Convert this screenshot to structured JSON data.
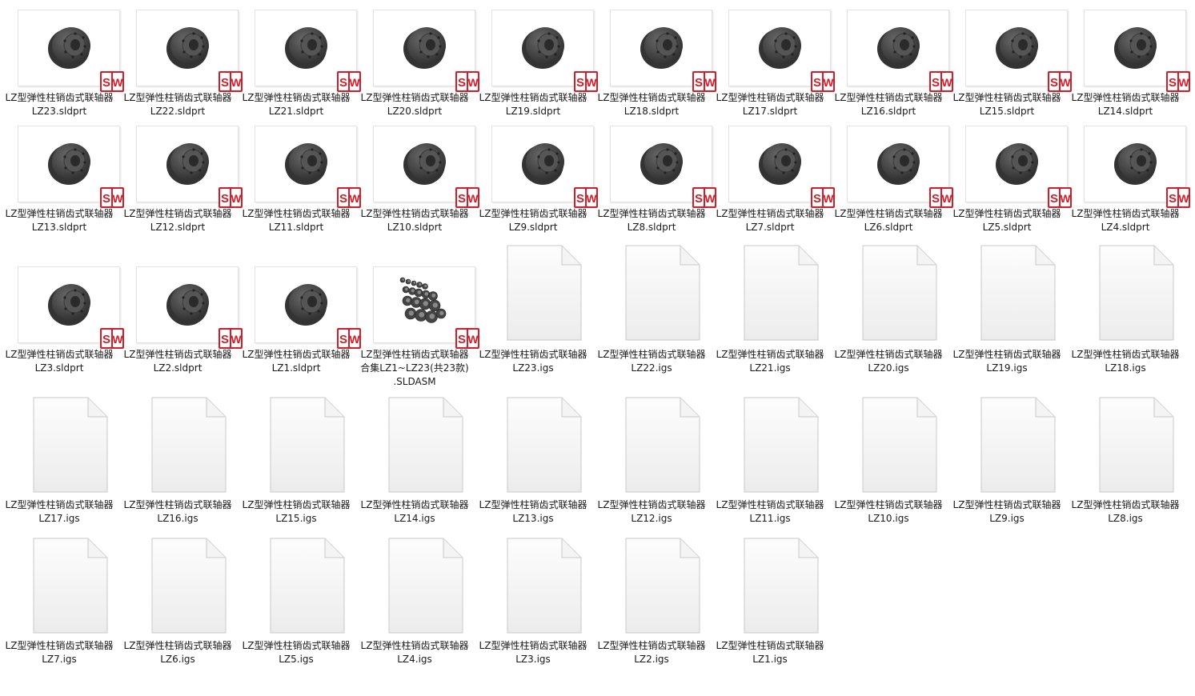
{
  "prefix": "LZ型弹性柱销齿式联轴器",
  "files": [
    {
      "name": "LZ23.sldprt",
      "kind": "sldprt"
    },
    {
      "name": "LZ22.sldprt",
      "kind": "sldprt"
    },
    {
      "name": "LZ21.sldprt",
      "kind": "sldprt"
    },
    {
      "name": "LZ20.sldprt",
      "kind": "sldprt"
    },
    {
      "name": "LZ19.sldprt",
      "kind": "sldprt"
    },
    {
      "name": "LZ18.sldprt",
      "kind": "sldprt"
    },
    {
      "name": "LZ17.sldprt",
      "kind": "sldprt"
    },
    {
      "name": "LZ16.sldprt",
      "kind": "sldprt"
    },
    {
      "name": "LZ15.sldprt",
      "kind": "sldprt"
    },
    {
      "name": "LZ14.sldprt",
      "kind": "sldprt"
    },
    {
      "name": "LZ13.sldprt",
      "kind": "sldprt"
    },
    {
      "name": "LZ12.sldprt",
      "kind": "sldprt"
    },
    {
      "name": "LZ11.sldprt",
      "kind": "sldprt"
    },
    {
      "name": "LZ10.sldprt",
      "kind": "sldprt"
    },
    {
      "name": "LZ9.sldprt",
      "kind": "sldprt"
    },
    {
      "name": "LZ8.sldprt",
      "kind": "sldprt"
    },
    {
      "name": "LZ7.sldprt",
      "kind": "sldprt"
    },
    {
      "name": "LZ6.sldprt",
      "kind": "sldprt"
    },
    {
      "name": "LZ5.sldprt",
      "kind": "sldprt"
    },
    {
      "name": "LZ4.sldprt",
      "kind": "sldprt"
    },
    {
      "name": "LZ3.sldprt",
      "kind": "sldprt"
    },
    {
      "name": "LZ2.sldprt",
      "kind": "sldprt"
    },
    {
      "name": "LZ1.sldprt",
      "kind": "sldprt"
    },
    {
      "name": "合集LZ1~LZ23(共23款)",
      "name2": ".SLDASM",
      "kind": "sldasm"
    },
    {
      "name": "LZ23.igs",
      "kind": "igs"
    },
    {
      "name": "LZ22.igs",
      "kind": "igs"
    },
    {
      "name": "LZ21.igs",
      "kind": "igs"
    },
    {
      "name": "LZ20.igs",
      "kind": "igs"
    },
    {
      "name": "LZ19.igs",
      "kind": "igs"
    },
    {
      "name": "LZ18.igs",
      "kind": "igs"
    },
    {
      "name": "LZ17.igs",
      "kind": "igs"
    },
    {
      "name": "LZ16.igs",
      "kind": "igs"
    },
    {
      "name": "LZ15.igs",
      "kind": "igs"
    },
    {
      "name": "LZ14.igs",
      "kind": "igs"
    },
    {
      "name": "LZ13.igs",
      "kind": "igs"
    },
    {
      "name": "LZ12.igs",
      "kind": "igs"
    },
    {
      "name": "LZ11.igs",
      "kind": "igs"
    },
    {
      "name": "LZ10.igs",
      "kind": "igs"
    },
    {
      "name": "LZ9.igs",
      "kind": "igs"
    },
    {
      "name": "LZ8.igs",
      "kind": "igs"
    },
    {
      "name": "LZ7.igs",
      "kind": "igs"
    },
    {
      "name": "LZ6.igs",
      "kind": "igs"
    },
    {
      "name": "LZ5.igs",
      "kind": "igs"
    },
    {
      "name": "LZ4.igs",
      "kind": "igs"
    },
    {
      "name": "LZ3.igs",
      "kind": "igs"
    },
    {
      "name": "LZ2.igs",
      "kind": "igs"
    },
    {
      "name": "LZ1.igs",
      "kind": "igs"
    }
  ],
  "icons": {
    "sldprt": "solidworks-part-thumbnail-icon",
    "sldasm": "solidworks-assembly-thumbnail-icon",
    "igs": "generic-document-icon"
  },
  "colors": {
    "sw_badge": "#d01f2a",
    "part_gray": "#4a4a4a"
  }
}
